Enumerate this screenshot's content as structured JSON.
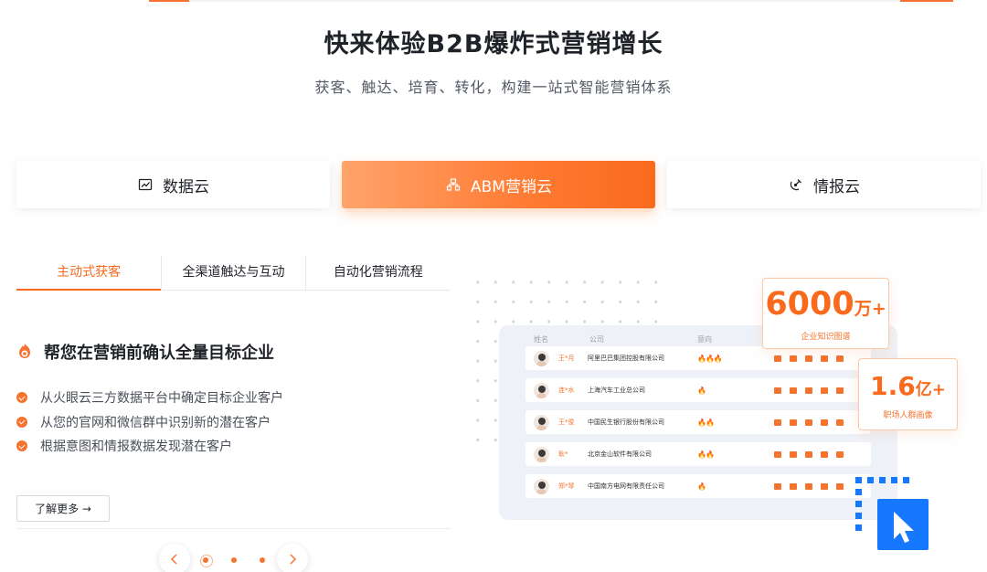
{
  "hero": {
    "title": "快来体验B2B爆炸式营销增长",
    "subtitle": "获客、触达、培育、转化，构建一站式智能营销体系"
  },
  "product_tabs": [
    {
      "label": "数据云",
      "icon": "chart-icon",
      "active": false
    },
    {
      "label": "ABM营销云",
      "icon": "network-icon",
      "active": true
    },
    {
      "label": "情报云",
      "icon": "satellite-icon",
      "active": false
    }
  ],
  "sub_tabs": [
    {
      "label": "主动式获客",
      "active": true
    },
    {
      "label": "全渠道触达与互动",
      "active": false
    },
    {
      "label": "自动化营销流程",
      "active": false
    }
  ],
  "feature": {
    "title": "帮您在营销前确认全量目标企业",
    "icon": "target-icon",
    "bullets": [
      "从火眼云三方数据平台中确定目标企业客户",
      "从您的官网和微信群中识别新的潜在客户",
      "根据意图和情报数据发现潜在客户"
    ],
    "learn_more": "了解更多 →"
  },
  "carousel": {
    "prev_icon": "chevron-left-icon",
    "next_icon": "chevron-right-icon",
    "dot_count": 3,
    "active_index": 0
  },
  "illustration": {
    "headers": {
      "name": "姓名",
      "company": "公司",
      "intent": "意向"
    },
    "rows": [
      {
        "name": "王*月",
        "company": "阿里巴巴集团控股有限公司",
        "fire": "🔥🔥🔥"
      },
      {
        "name": "连*水",
        "company": "上海汽车工业总公司",
        "fire": "🔥"
      },
      {
        "name": "王*俊",
        "company": "中国民生银行股份有限公司",
        "fire": "🔥🔥"
      },
      {
        "name": "耿*",
        "company": "北京金山软件有限公司",
        "fire": "🔥🔥"
      },
      {
        "name": "郑*琴",
        "company": "中国南方电网有限责任公司",
        "fire": "🔥"
      }
    ],
    "stat1": {
      "value": "6000",
      "unit": "万+",
      "label": "企业知识图谱"
    },
    "stat2": {
      "value": "1.6",
      "unit": "亿+",
      "label": "职场人群画像"
    }
  },
  "colors": {
    "accent": "#f96a1d",
    "accent_light": "#ffa46b",
    "text": "#1f2329",
    "muted": "#545a66",
    "card_bg": "#eef2f8",
    "cursor_blue": "#1677ff"
  }
}
